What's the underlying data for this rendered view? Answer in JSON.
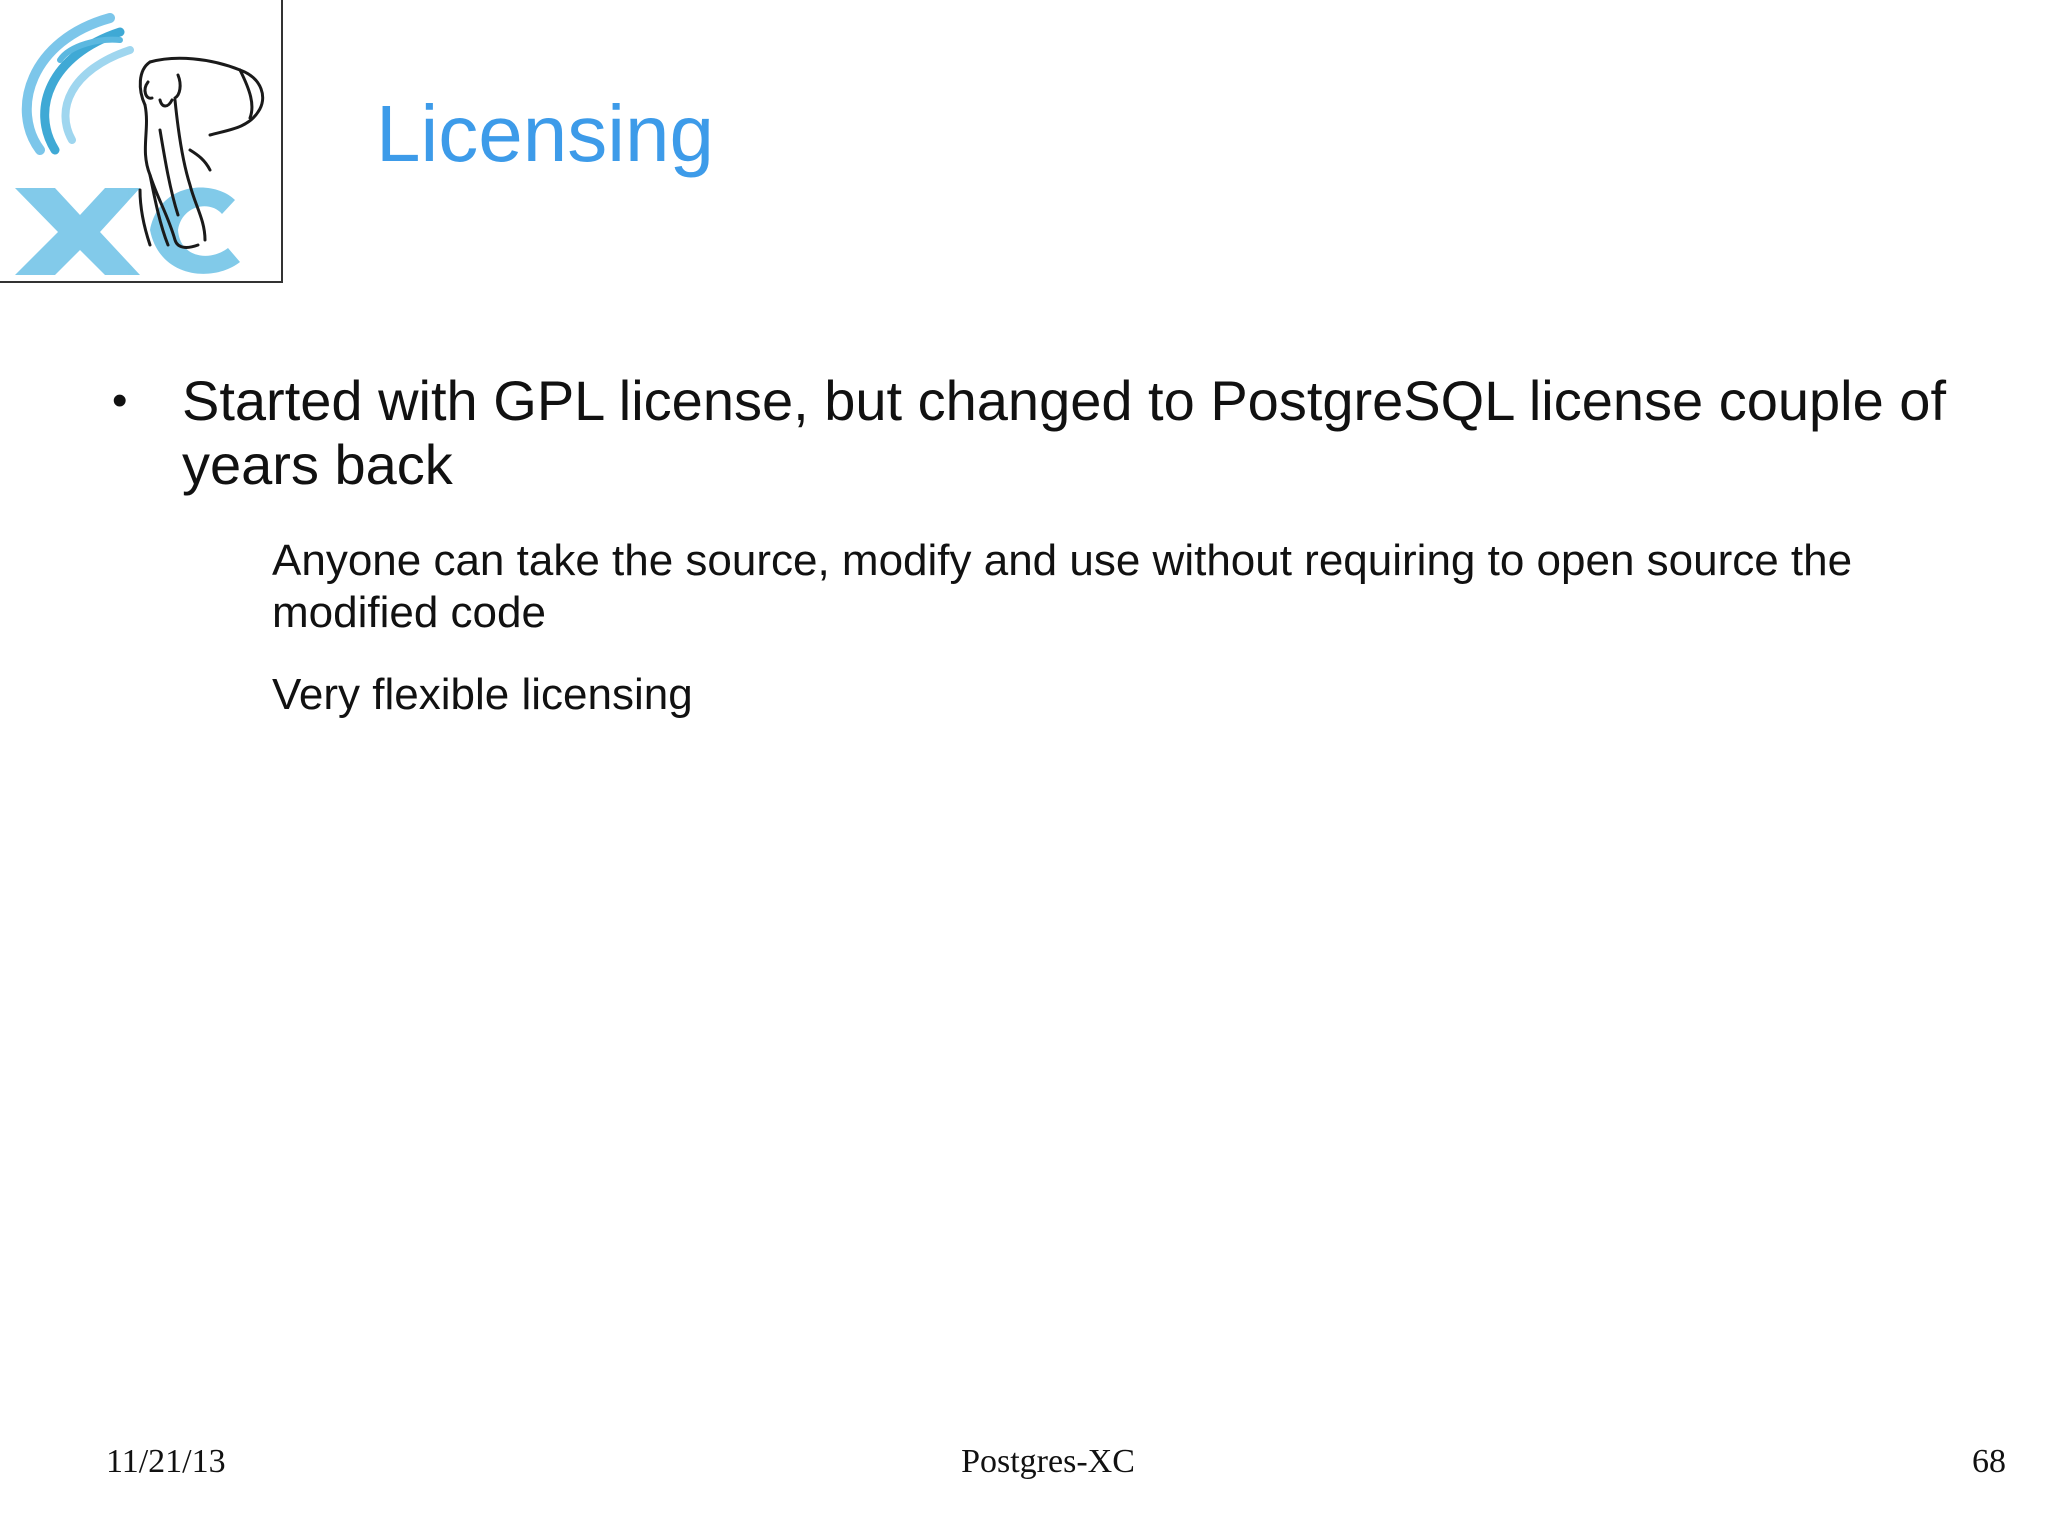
{
  "slide": {
    "title": "Licensing",
    "bullets": [
      {
        "text": "Started with GPL license, but changed to PostgreSQL license couple of years back",
        "sub_items": [
          "Anyone can take the source, modify and use without requiring to open source the modified code",
          "Very flexible licensing"
        ]
      }
    ]
  },
  "logo": {
    "text": "XC",
    "icon": "postgres-xc-elephant-logo",
    "colors": {
      "accent": "#5bb8e0",
      "swoosh": "#3fa9d5",
      "elephant": "#1a1a1a"
    }
  },
  "footer": {
    "date": "11/21/13",
    "center": "Postgres-XC",
    "page": "68"
  },
  "colors": {
    "title": "#3d9be9",
    "text": "#111111",
    "background": "#ffffff"
  }
}
